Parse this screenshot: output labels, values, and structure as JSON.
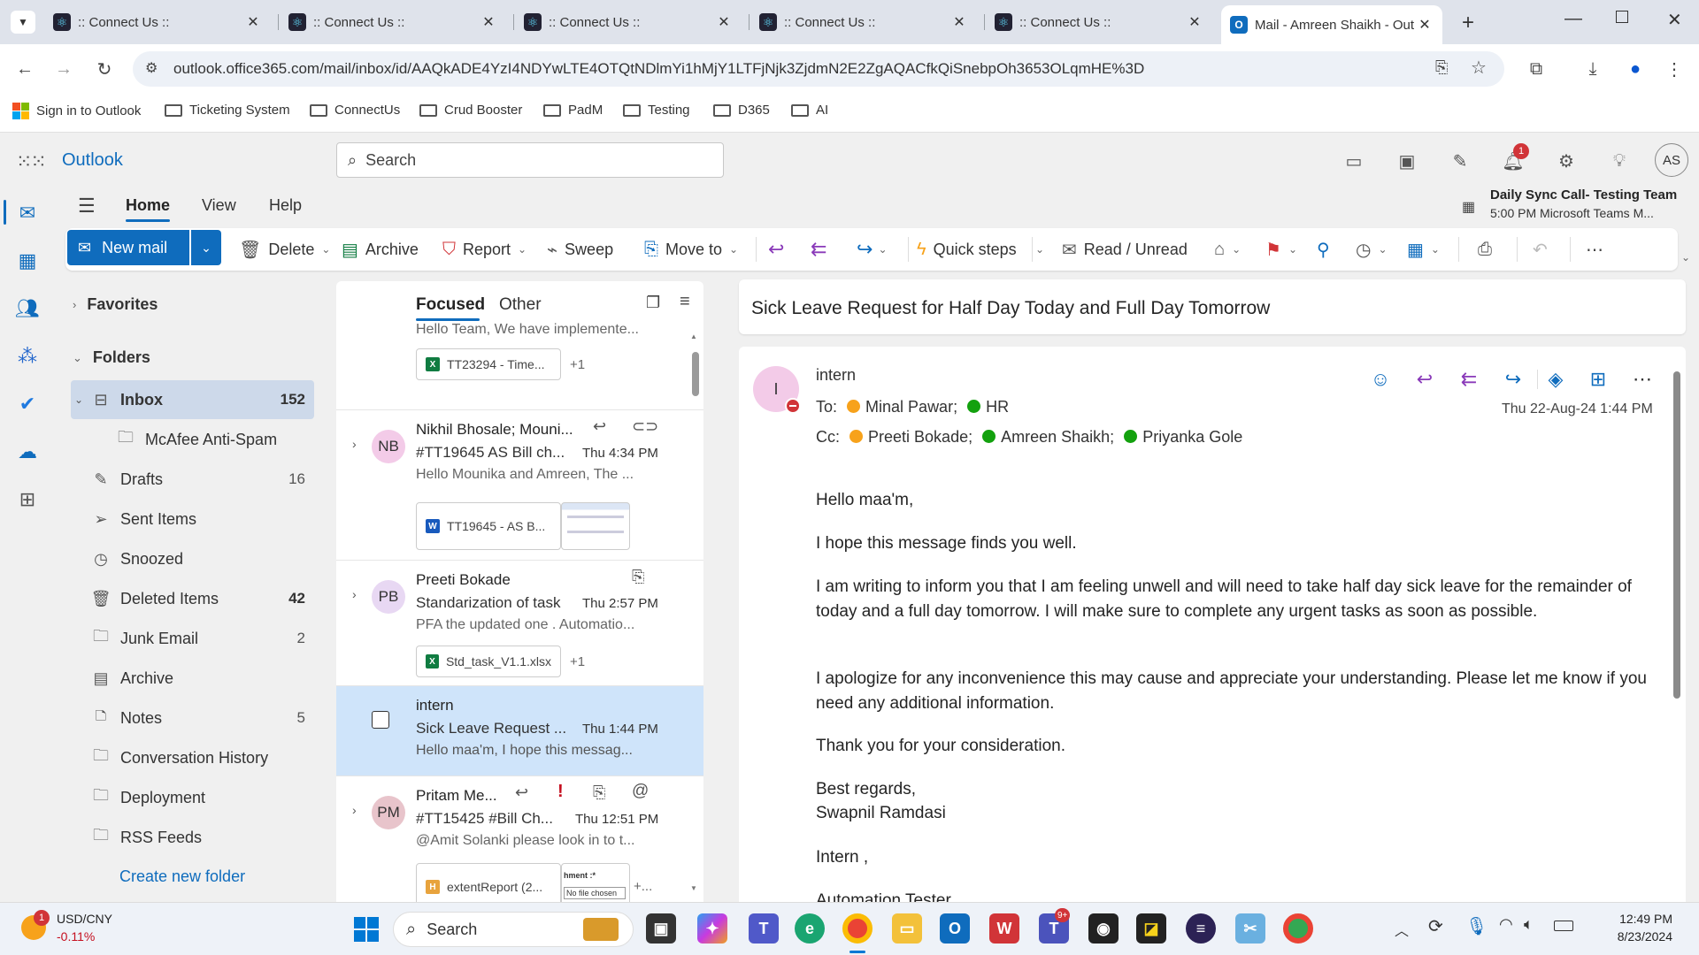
{
  "browser": {
    "tabs": [
      {
        "title": ":: Connect Us ::"
      },
      {
        "title": ":: Connect Us ::"
      },
      {
        "title": ":: Connect Us ::"
      },
      {
        "title": ":: Connect Us ::"
      },
      {
        "title": ":: Connect Us ::"
      },
      {
        "title": "Mail - Amreen Shaikh - Out"
      }
    ],
    "url": "outlook.office365.com/mail/inbox/id/AAQkADE4YzI4NDYwLTE4OTQtNDlmYi1hMjY1LTFjNjk3ZjdmN2E2ZgAQACfkQiSnebpOh3653OLqmHE%3D",
    "bookmarks": [
      "Sign in to Outlook",
      "Ticketing System",
      "ConnectUs",
      "Crud Booster",
      "PadM",
      "Testing",
      "D365",
      "AI"
    ]
  },
  "app": {
    "name": "Outlook",
    "search_placeholder": "Search",
    "notification_count": "1",
    "avatar_initials": "AS"
  },
  "ribbon": {
    "tabs": [
      "Home",
      "View",
      "Help"
    ],
    "event_title": "Daily Sync Call- Testing Team",
    "event_detail": "5:00 PM Microsoft Teams M...",
    "new_mail": "New mail",
    "delete": "Delete",
    "archive": "Archive",
    "report": "Report",
    "sweep": "Sweep",
    "move_to": "Move to",
    "quick_steps": "Quick steps",
    "read_unread": "Read / Unread"
  },
  "folders": {
    "favorites": "Favorites",
    "folders_label": "Folders",
    "items": [
      {
        "name": "Inbox",
        "count": "152"
      },
      {
        "name": "McAfee Anti-Spam",
        "count": ""
      },
      {
        "name": "Drafts",
        "count": "16"
      },
      {
        "name": "Sent Items",
        "count": ""
      },
      {
        "name": "Snoozed",
        "count": ""
      },
      {
        "name": "Deleted Items",
        "count": "42"
      },
      {
        "name": "Junk Email",
        "count": "2"
      },
      {
        "name": "Archive",
        "count": ""
      },
      {
        "name": "Notes",
        "count": "5"
      },
      {
        "name": "Conversation History",
        "count": ""
      },
      {
        "name": "Deployment",
        "count": ""
      },
      {
        "name": "RSS Feeds",
        "count": ""
      }
    ],
    "create_new": "Create new folder"
  },
  "list": {
    "focused": "Focused",
    "other": "Other",
    "partial_preview": "Hello Team, We have implemente...",
    "partial_attachment": "TT23294 - Time...",
    "partial_more": "+1",
    "messages": [
      {
        "initials": "NB",
        "sender": "Nikhil Bhosale; Mouni...",
        "subject": "#TT19645 AS Bill ch...",
        "time": "Thu 4:34 PM",
        "preview": "Hello Mounika and Amreen, The ...",
        "attachment": "TT19645 - AS B...",
        "more": ""
      },
      {
        "initials": "PB",
        "sender": "Preeti Bokade",
        "subject": "Standarization of task",
        "time": "Thu 2:57 PM",
        "preview": "PFA the updated one . Automatio...",
        "attachment": "Std_task_V1.1.xlsx",
        "more": "+1"
      },
      {
        "initials": "",
        "sender": "intern",
        "subject": "Sick Leave Request ...",
        "time": "Thu 1:44 PM",
        "preview": "Hello maa'm, I hope this messag...",
        "attachment": "",
        "more": ""
      },
      {
        "initials": "PM",
        "sender": "Pritam Me...",
        "subject": "#TT15425 #Bill Ch...",
        "time": "Thu 12:51 PM",
        "preview": "@Amit Solanki please look in to t...",
        "attachment": "extentReport (2...",
        "more": "+..."
      }
    ],
    "thumb_text_1": "hment :*",
    "thumb_text_2": "No file chosen"
  },
  "reading": {
    "subject": "Sick Leave Request for Half Day Today and Full Day Tomorrow",
    "sender_initial": "I",
    "sender": "intern",
    "to_label": "To:",
    "to": [
      "Minal Pawar;",
      "HR"
    ],
    "cc_label": "Cc:",
    "cc": [
      "Preeti Bokade;",
      "Amreen Shaikh;",
      "Priyanka Gole"
    ],
    "date": "Thu 22-Aug-24 1:44 PM",
    "body": [
      "Hello maa'm,",
      "I hope this message finds you well.",
      "I am writing to inform you that I am feeling unwell and will need to take half day sick leave for the remainder of today and a full day tomorrow. I will make sure to complete any urgent tasks as soon as possible.",
      "I apologize for any inconvenience this may cause and appreciate your understanding. Please let me know if you need any additional information.",
      "Thank you for your consideration.",
      "Best regards,",
      "Swapnil Ramdasi",
      "Intern ,",
      "Automation Tester"
    ]
  },
  "taskbar": {
    "stock_name": "USD/CNY",
    "stock_change": "-0.11%",
    "stock_badge": "1",
    "search": "Search",
    "time": "12:49 PM",
    "date": "8/23/2024",
    "teams_badge": "9+"
  },
  "colors": {
    "accent": "#0f6cbd",
    "selected": "#cfe4fa",
    "inbox_bg": "#d6e1f0",
    "status_green": "#13a10e",
    "status_orange": "#f7a21b",
    "status_red": "#d13438"
  }
}
